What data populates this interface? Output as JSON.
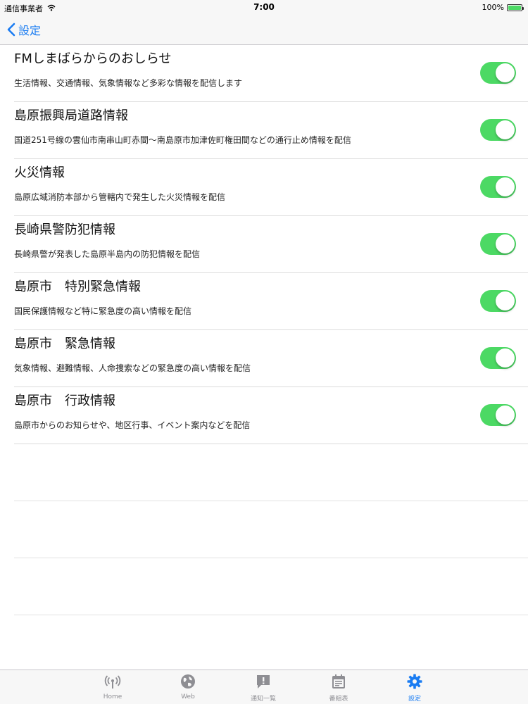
{
  "status_bar": {
    "carrier": "通信事業者",
    "time": "7:00",
    "battery_text": "100%"
  },
  "nav": {
    "back_label": "設定"
  },
  "settings": [
    {
      "title": "FMしまばらからのおしらせ",
      "description": "生活情報、交通情報、気象情報など多彩な情報を配信します",
      "enabled": true
    },
    {
      "title": "島原振興局道路情報",
      "description": "国道251号線の雲仙市南串山町赤間～南島原市加津佐町権田間などの通行止め情報を配信",
      "enabled": true
    },
    {
      "title": "火災情報",
      "description": "島原広域消防本部から管轄内で発生した火災情報を配信",
      "enabled": true
    },
    {
      "title": "長崎県警防犯情報",
      "description": "長崎県警が発表した島原半島内の防犯情報を配信",
      "enabled": true
    },
    {
      "title": "島原市　特別緊急情報",
      "description": "国民保護情報など特に緊急度の高い情報を配信",
      "enabled": true
    },
    {
      "title": "島原市　緊急情報",
      "description": "気象情報、避難情報、人命捜索などの緊急度の高い情報を配信",
      "enabled": true
    },
    {
      "title": "島原市　行政情報",
      "description": "島原市からのお知らせや、地区行事、イベント案内などを配信",
      "enabled": true
    }
  ],
  "tab_bar": {
    "tabs": [
      {
        "label": "Home",
        "icon": "antenna-icon",
        "active": false
      },
      {
        "label": "Web",
        "icon": "globe-icon",
        "active": false
      },
      {
        "label": "通知一覧",
        "icon": "notice-icon",
        "active": false
      },
      {
        "label": "番組表",
        "icon": "calendar-icon",
        "active": false
      },
      {
        "label": "設定",
        "icon": "gear-icon",
        "active": true
      }
    ]
  },
  "colors": {
    "accent": "#1a7cf2",
    "toggle_on": "#4cd964",
    "tab_inactive": "#8e8e93"
  }
}
